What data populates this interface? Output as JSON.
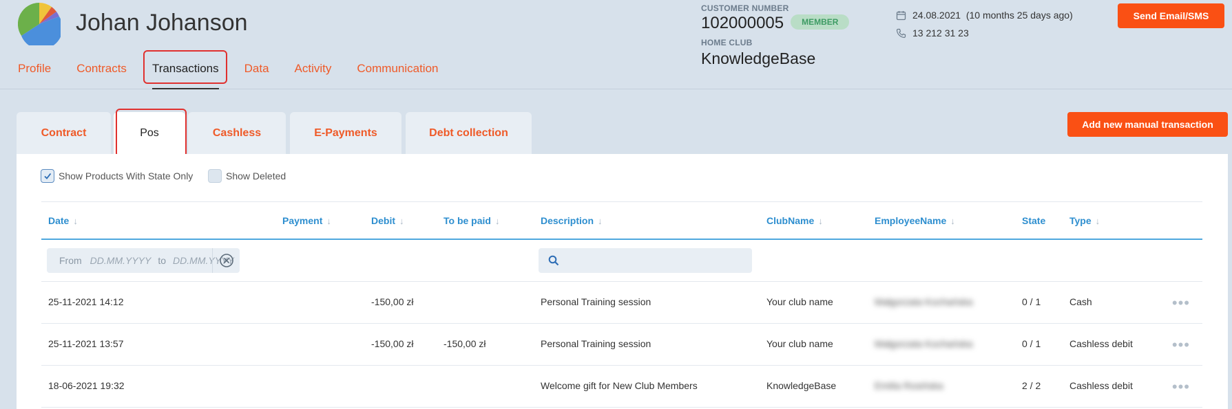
{
  "customer": {
    "name": "Johan Johanson",
    "number_label": "CUSTOMER NUMBER",
    "number": "102000005",
    "status": "MEMBER",
    "home_club_label": "HOME CLUB",
    "home_club": "KnowledgeBase",
    "date": "24.08.2021",
    "date_ago": "(10 months 25 days ago)",
    "phone": "13 212 31 23"
  },
  "nav": [
    "Profile",
    "Contracts",
    "Transactions",
    "Data",
    "Activity",
    "Communication"
  ],
  "send_button": "Send Email/SMS",
  "tabs": [
    "Contract",
    "Pos",
    "Cashless",
    "E-Payments",
    "Debt collection"
  ],
  "add_button": "Add new manual transaction",
  "filters": {
    "show_state_only": "Show Products With State Only",
    "show_deleted": "Show Deleted",
    "from_label": "From",
    "to_label": "to",
    "date_placeholder": "DD.MM.YYYY"
  },
  "columns": [
    "Date",
    "Payment",
    "Debit",
    "To be paid",
    "Description",
    "ClubName",
    "EmployeeName",
    "State",
    "Type"
  ],
  "rows": [
    {
      "date": "25-11-2021 14:12",
      "payment": "",
      "debit": "-150,00 zł",
      "to_be_paid": "",
      "description": "Personal Training session",
      "club": "Your club name",
      "employee": "Małgorzata Kochańska",
      "state": "0 / 1",
      "type": "Cash"
    },
    {
      "date": "25-11-2021 13:57",
      "payment": "",
      "debit": "-150,00 zł",
      "to_be_paid": "-150,00 zł",
      "description": "Personal Training session",
      "club": "Your club name",
      "employee": "Małgorzata Kochańska",
      "state": "0 / 1",
      "type": "Cashless debit"
    },
    {
      "date": "18-06-2021 19:32",
      "payment": "",
      "debit": "",
      "to_be_paid": "",
      "description": "Welcome gift for New Club Members",
      "club": "KnowledgeBase",
      "employee": "Emilia Rosińska",
      "state": "2 / 2",
      "type": "Cashless debit"
    }
  ],
  "colors": {
    "accent": "#fa5014",
    "link": "#2d8ecf",
    "background": "#d7e1eb",
    "highlight": "#e0302e"
  }
}
